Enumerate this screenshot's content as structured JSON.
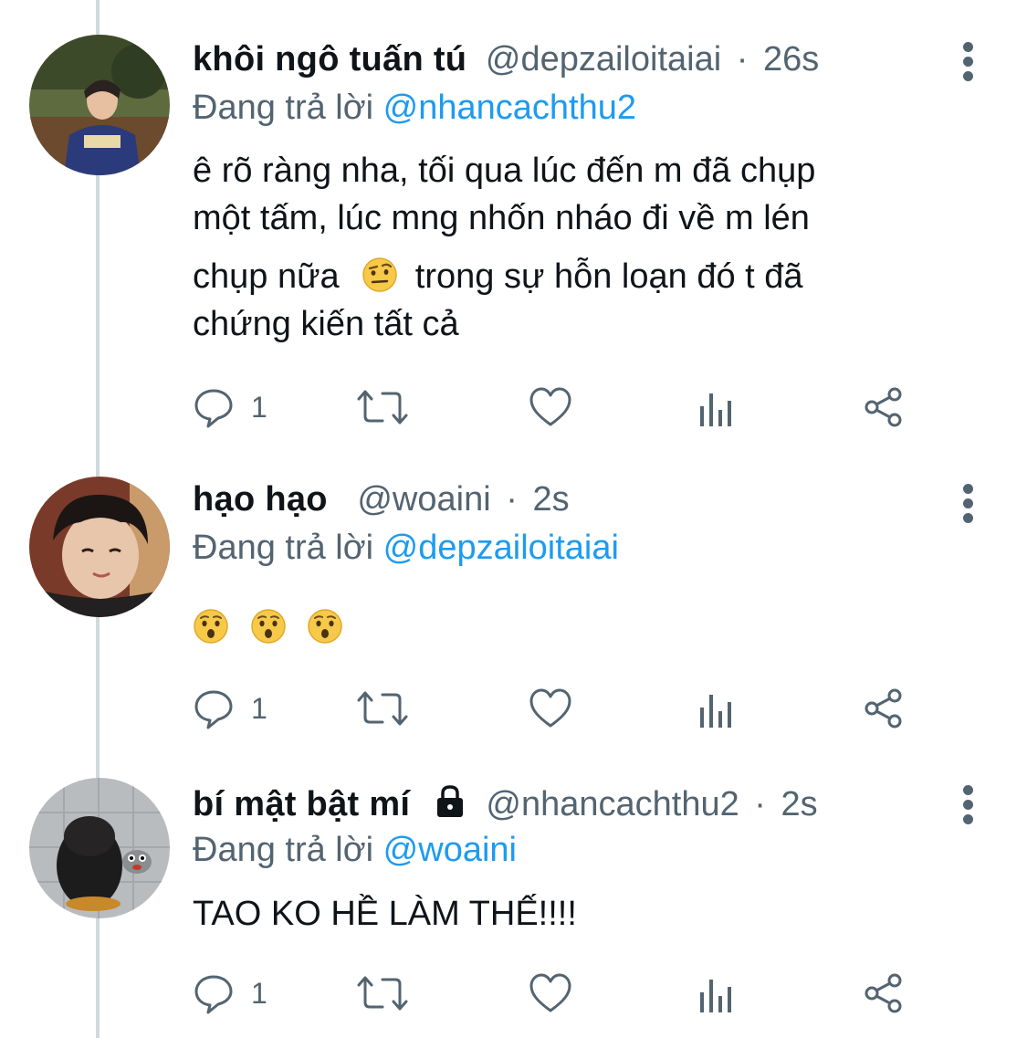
{
  "tweets": [
    {
      "name": "khôi ngô tuấn tú",
      "handle": "@depzailoitaiai",
      "separator": "·",
      "time": "26s",
      "replying_prefix": "Đang trả lời",
      "replying_to": "@nhancachthu2",
      "text_lines": [
        "ê rõ ràng nha, tối qua lúc đến m đã chụp",
        "một tấm, lúc mng nhốn nháo đi về m lén"
      ],
      "text_line3_a": "chụp nữa",
      "text_line3_emoji": "raised-eyebrow-emoji",
      "text_line3_b": " trong sự hỗn loạn đó t đã",
      "text_line4": "chứng kiến tất cả",
      "reply_count": "1",
      "locked": false
    },
    {
      "name": "hạo hạo",
      "handle": "@woaini",
      "separator": "·",
      "time": "2s",
      "replying_prefix": "Đang trả lời",
      "replying_to": "@depzailoitaiai",
      "emojis": [
        "hushed-face-emoji",
        "hushed-face-emoji",
        "hushed-face-emoji"
      ],
      "reply_count": "1",
      "locked": false
    },
    {
      "name": "bí mật bật mí",
      "handle": "@nhancachthu2",
      "separator": "·",
      "time": "2s",
      "replying_prefix": "Đang trả lời",
      "replying_to": "@woaini",
      "text": "TAO KO HỀ LÀM THẾ!!!!",
      "reply_count": "1",
      "locked": true
    }
  ],
  "icons": {
    "reply": "reply-icon",
    "retweet": "retweet-icon",
    "like": "heart-icon",
    "analytics": "analytics-icon",
    "share": "share-icon",
    "more": "more-vertical-icon",
    "lock": "lock-icon"
  },
  "colors": {
    "text_primary": "#0f1419",
    "text_secondary": "#536471",
    "mention": "#1d9bf0",
    "thread_line": "#cfd9de"
  }
}
